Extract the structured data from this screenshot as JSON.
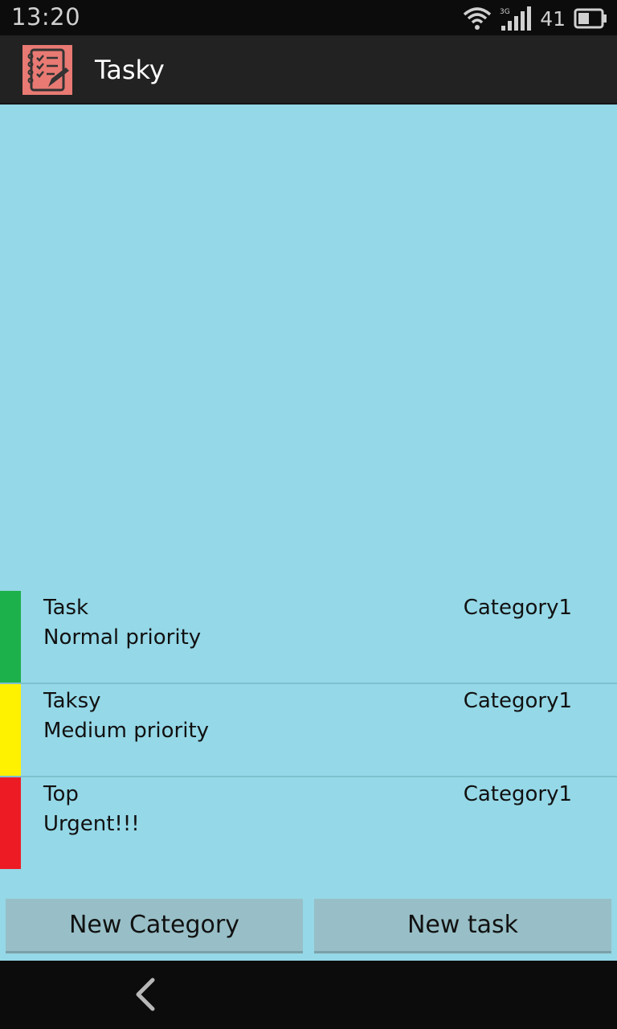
{
  "status_bar": {
    "time": "13:20",
    "network_label": "3G",
    "battery_level": "41",
    "icons": [
      "wifi-icon",
      "signal-icon",
      "battery-icon"
    ]
  },
  "action_bar": {
    "title": "Tasky",
    "icon": "notepad-checklist-icon",
    "icon_color": "#e87a73"
  },
  "tasks": [
    {
      "name": "Task",
      "description": "Normal priority",
      "category": "Category1",
      "priority_color": "#1db14b"
    },
    {
      "name": "Taksy",
      "description": "Medium priority",
      "category": "Category1",
      "priority_color": "#fff200"
    },
    {
      "name": "Top",
      "description": "Urgent!!!",
      "category": "Category1",
      "priority_color": "#ed1c24"
    }
  ],
  "buttons": {
    "new_category": "New Category",
    "new_task": "New task"
  },
  "nav_bar": {
    "back_icon": "back-chevron-icon"
  },
  "colors": {
    "background": "#95d8e7",
    "action_bar": "#222222",
    "button": "#98bfc7"
  }
}
